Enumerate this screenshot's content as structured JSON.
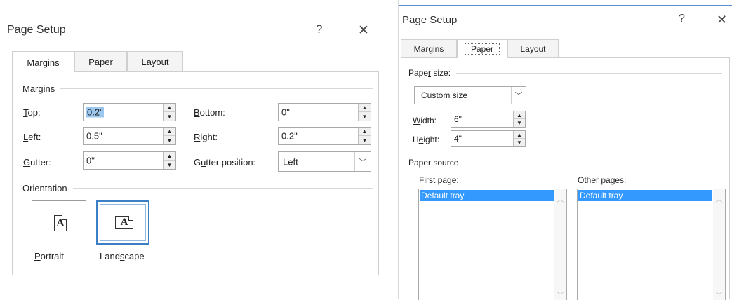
{
  "left_dialog": {
    "title": "Page Setup",
    "help": "?",
    "close": "✕",
    "tabs": [
      "Margins",
      "Paper",
      "Layout"
    ],
    "margins_section": "Margins",
    "top_label": "Top:",
    "top_value": "0.2\"",
    "bottom_label": "Bottom:",
    "bottom_value": "0\"",
    "left_label": "Left:",
    "left_value": "0.5\"",
    "right_label": "Right:",
    "right_value": "0.2\"",
    "gutter_label": "Gutter:",
    "gutter_value": "0\"",
    "gutter_position_label": "Gutter position:",
    "gutter_position_value": "Left",
    "orientation_section": "Orientation",
    "portrait_label": "Portrait",
    "landscape_label": "Landscape",
    "page_icon_glyph": "A"
  },
  "right_dialog": {
    "title": "Page Setup",
    "help": "?",
    "close": "✕",
    "tabs": [
      "Margins",
      "Paper",
      "Layout"
    ],
    "paper_size_section": "Paper size:",
    "paper_size_value": "Custom size",
    "width_label": "Width:",
    "width_value": "6\"",
    "height_label": "Height:",
    "height_value": "4\"",
    "paper_source_section": "Paper source",
    "first_page_label": "First page:",
    "first_page_selected": "Default tray",
    "other_pages_label": "Other pages:",
    "other_pages_selected": "Default tray"
  },
  "icons": {
    "spin_up": "▲",
    "spin_down": "▼",
    "dropdown": "﹀",
    "scroll_up": "︿",
    "scroll_down": "﹀"
  },
  "colors": {
    "selection_blue": "#3399ff",
    "selected_text_highlight": "#9cc7ef",
    "focus_border": "#3c7fc4"
  }
}
